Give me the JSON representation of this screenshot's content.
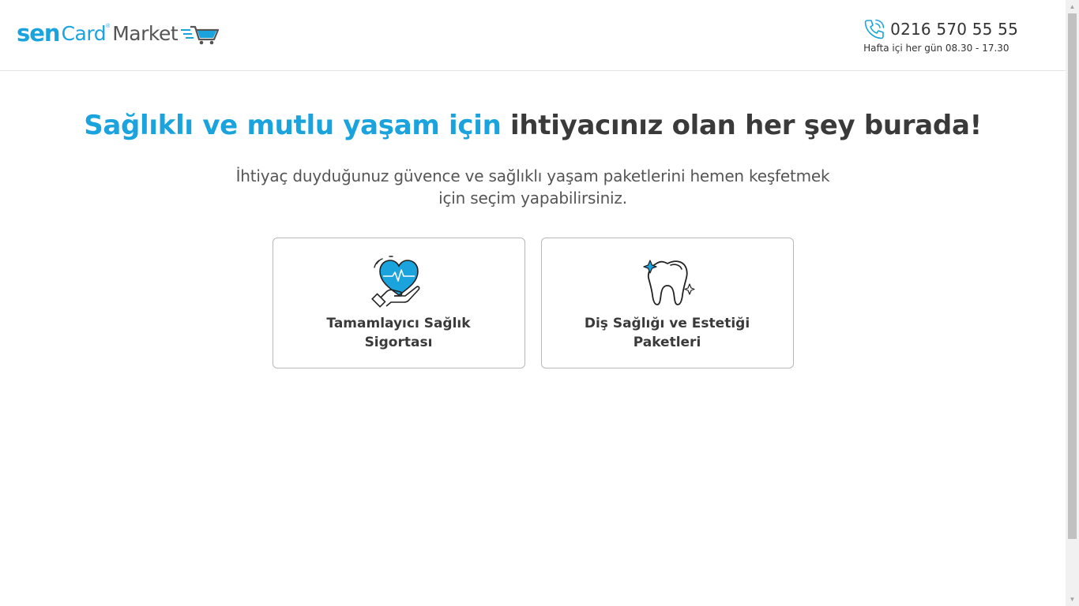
{
  "header": {
    "logo": {
      "part1": "sen",
      "part2": "Card",
      "registered": "®",
      "part3": "Market"
    },
    "phone": "0216 570 55 55",
    "hours": "Hafta içi her gün 08.30 - 17.30"
  },
  "main": {
    "headline_accent": "Sağlıklı ve mutlu yaşam için",
    "headline_rest": "ihtiyacınız olan her şey burada!",
    "subtitle": "İhtiyaç duyduğunuz güvence ve sağlıklı yaşam paketlerini hemen keşfetmek için seçim yapabilirsiniz.",
    "cards": [
      {
        "title": "Tamamlayıcı Sağlık Sigortası",
        "icon": "heart-hand-icon"
      },
      {
        "title": "Diş Sağlığı ve Estetiği Paketleri",
        "icon": "tooth-icon"
      }
    ]
  },
  "colors": {
    "accent": "#1aa3dd",
    "text": "#3a3a3a",
    "border": "#b8b8b8"
  }
}
